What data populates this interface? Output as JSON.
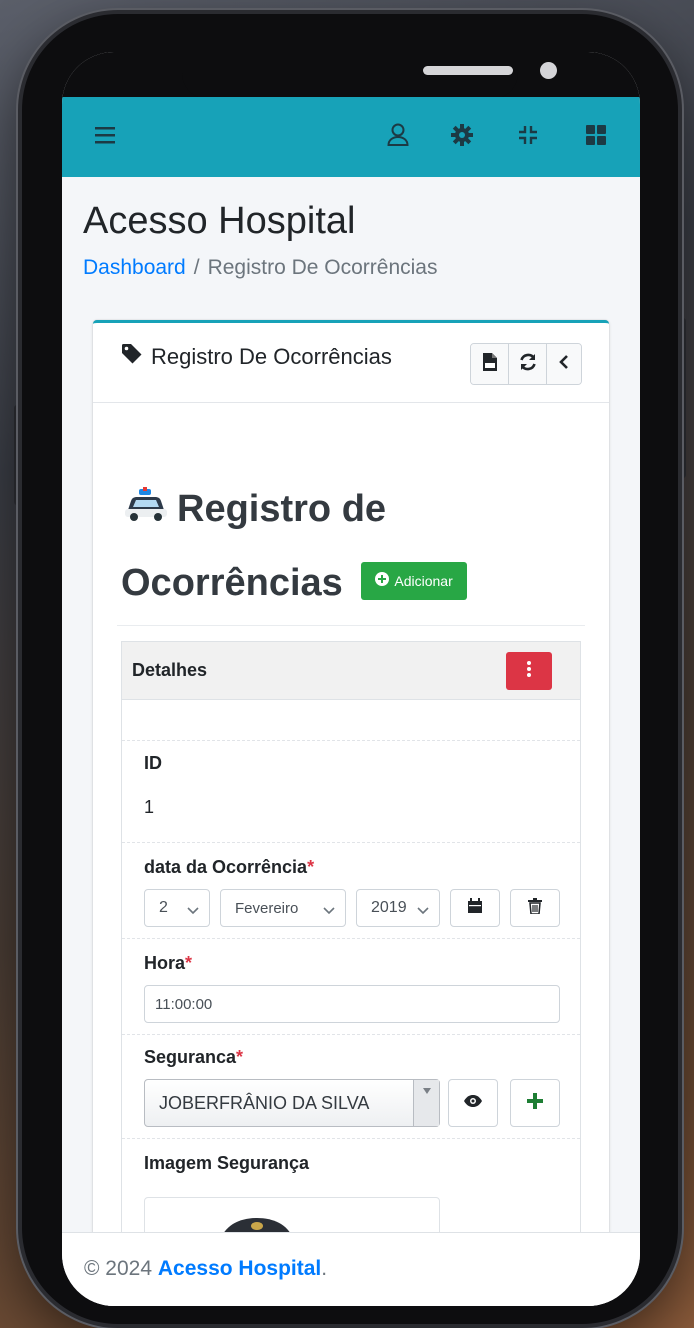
{
  "colors": {
    "primary": "#17a2b8",
    "link": "#007bff",
    "success": "#28a745",
    "danger": "#dc3545"
  },
  "topbar": {
    "icons": [
      "menu-icon",
      "user-icon",
      "gear-icon",
      "compress-icon",
      "grid-icon"
    ]
  },
  "page": {
    "title": "Acesso Hospital",
    "breadcrumb": {
      "home": "Dashboard",
      "separator": "/",
      "current": "Registro De Ocorrências"
    }
  },
  "card": {
    "title": "Registro De Ocorrências",
    "tools": [
      "csv-icon",
      "refresh-icon",
      "chevron-left-icon"
    ],
    "heading_line1": "Registro de",
    "heading_line2": "Ocorrências",
    "add_label": "Adicionar"
  },
  "details": {
    "header": "Detalhes",
    "id_label": "ID",
    "id_value": "1",
    "date_label": "data da Ocorrência",
    "date_required": "*",
    "date_day": "2",
    "date_month": "Fevereiro",
    "date_year": "2019",
    "hour_label": "Hora",
    "hour_required": "*",
    "hour_value": "11:00:00",
    "guard_label": "Seguranca",
    "guard_required": "*",
    "guard_value": "JOBERFRÂNIO DA SILVA",
    "image_label": "Imagem Segurança"
  },
  "footer": {
    "copyright": "© 2024",
    "brand": "Acesso Hospital",
    "suffix": "."
  }
}
